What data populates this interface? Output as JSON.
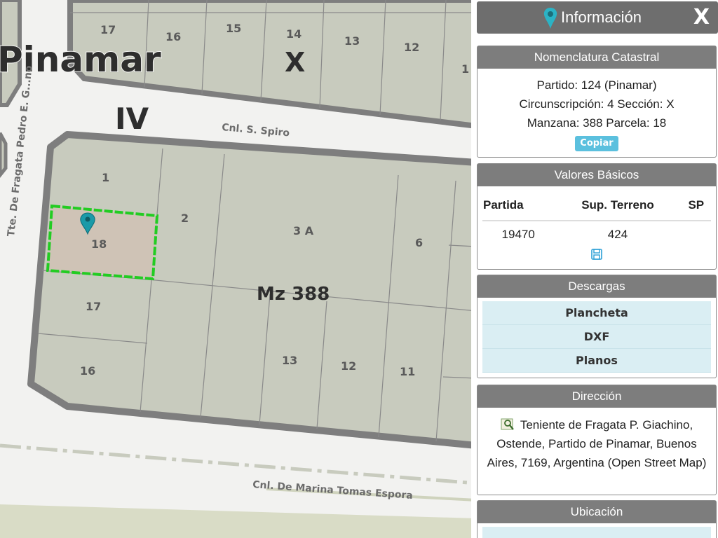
{
  "map": {
    "city_label": "Pinamar",
    "section_roman": "IV",
    "section_x": "X",
    "block_label": "Mz 388",
    "streets": {
      "spiro": "Cnl. S. Spiro",
      "espora": "Cnl. De Marina Tomas Espora",
      "fragata": "Tte. De Fragata Pedro E. G...no"
    },
    "top_lots": [
      "17",
      "16",
      "15",
      "14",
      "13",
      "12",
      "1"
    ],
    "lots": [
      "1",
      "2",
      "3 A",
      "6",
      "18",
      "17",
      "16",
      "13",
      "12",
      "11"
    ],
    "selected_color": "#22cc22",
    "pin_color": "#1a9aa8"
  },
  "panel": {
    "title": "Información",
    "close": "X",
    "nomenclatura": {
      "header": "Nomenclatura Catastral",
      "line1": "Partido: 124 (Pinamar)",
      "line2": "Circunscripción: 4 Sección: X",
      "line3": "Manzana: 388 Parcela: 18",
      "copy_label": "Copiar"
    },
    "valores": {
      "header": "Valores Básicos",
      "col1": "Partida",
      "col2": "Sup. Terreno",
      "col3": "SP",
      "partida": "19470",
      "sup": "424",
      "sp": ""
    },
    "descargas": {
      "header": "Descargas",
      "items": [
        "Plancheta",
        "DXF",
        "Planos"
      ]
    },
    "direccion": {
      "header": "Dirección",
      "text": "Teniente de Fragata P. Giachino, Ostende, Partido de Pinamar, Buenos Aires, 7169, Argentina (Open Street Map)"
    },
    "ubicacion": {
      "header": "Ubicación"
    }
  }
}
